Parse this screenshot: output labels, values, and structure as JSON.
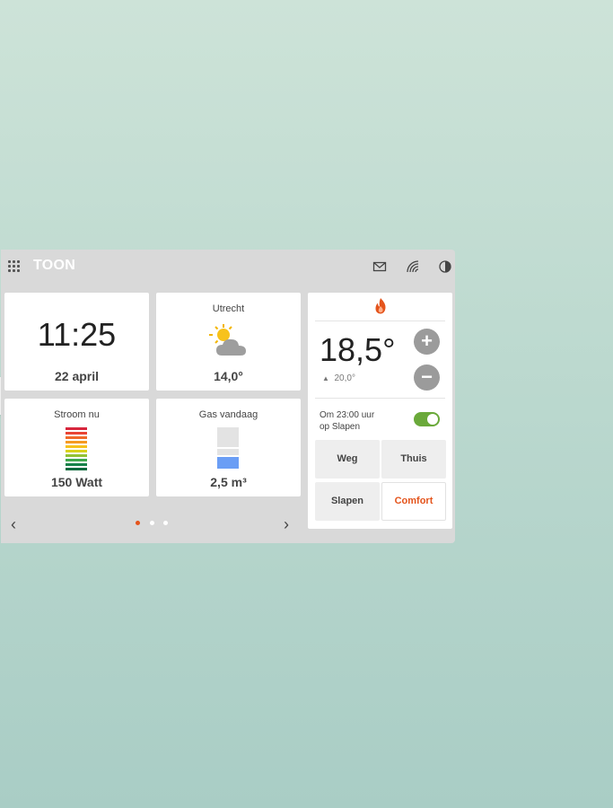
{
  "topbar": {
    "brand": "TOON",
    "icons": [
      "apps-grid-icon",
      "mail-icon",
      "signal-icon",
      "contrast-icon"
    ]
  },
  "tiles": {
    "clock": {
      "time": "11:25",
      "date": "22 april"
    },
    "weather": {
      "city": "Utrecht",
      "temperature": "14,0°",
      "icon": "partly-cloudy-icon"
    },
    "power": {
      "label": "Stroom nu",
      "value": "150 Watt"
    },
    "gas": {
      "label": "Gas vandaag",
      "value": "2,5 m³",
      "fill_fraction": 0.35
    }
  },
  "thermostat": {
    "flame_icon": "flame-icon",
    "current_temp": "18,5°",
    "setpoint": "20,0°",
    "plus": "+",
    "minus": "−",
    "schedule_line1": "Om 23:00 uur",
    "schedule_line2": "op Slapen",
    "program_on": true,
    "modes": [
      "Weg",
      "Thuis",
      "Slapen",
      "Comfort"
    ],
    "active_mode": "Comfort"
  },
  "pager": {
    "prev": "‹",
    "next": "›",
    "pages": 3,
    "current": 1
  },
  "colors": {
    "accent": "#e4541c",
    "toggle": "#6aa93a",
    "gas_fill": "#6b9ef5"
  }
}
